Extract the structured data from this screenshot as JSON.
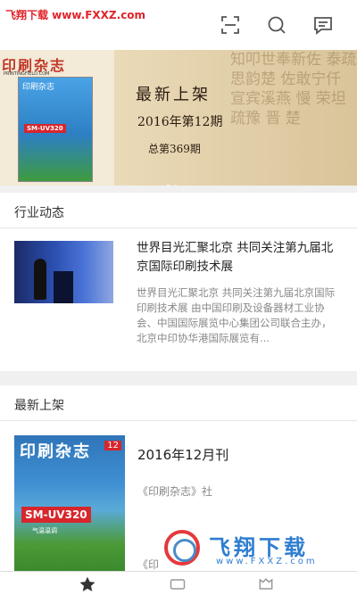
{
  "watermark_top": "飞翔下载 www.FXXZ.com",
  "header": {
    "icons": [
      "scan-icon",
      "search-icon",
      "message-icon"
    ]
  },
  "banner": {
    "magazine_logo": "印刷杂志",
    "magazine_site": "PRINTINGFIELD.COM",
    "cover_badge": "SM-UV320",
    "title": "最新上架",
    "issue": "2016年第12期",
    "total_issue": "总第369期",
    "background_chars": "知叩世奉新佐 泰疏思韵楚 佐敢宁仟 宣宾溪燕 慢 荣坦 疏豫 晋 楚",
    "slides": 2,
    "active_slide": 1
  },
  "industry": {
    "section_title": "行业动态",
    "item": {
      "title": "世界目光汇聚北京 共同关注第九届北京国际印刷技术展",
      "desc": "世界目光汇聚北京 共同关注第九届北京国际印刷技术展 由中国印刷及设备器材工业协会、中国国际展览中心集团公司联合主办，北京中印协华港国际展览有..."
    }
  },
  "latest": {
    "section_title": "最新上架",
    "item": {
      "cover_title": "印刷杂志",
      "cover_number": "12",
      "cover_badge": "SM-UV320",
      "cover_sub": "气温温调",
      "title": "2016年12月刊",
      "publisher": "《印刷杂志》社",
      "publisher_cut": "《印"
    }
  },
  "watermark_bottom": {
    "text": "飞翔下载",
    "url": "www.FXXZ.com"
  },
  "tabbar": {
    "icons": [
      "star-icon",
      "bookshelf-icon",
      "user-icon"
    ],
    "active_index": 0
  }
}
